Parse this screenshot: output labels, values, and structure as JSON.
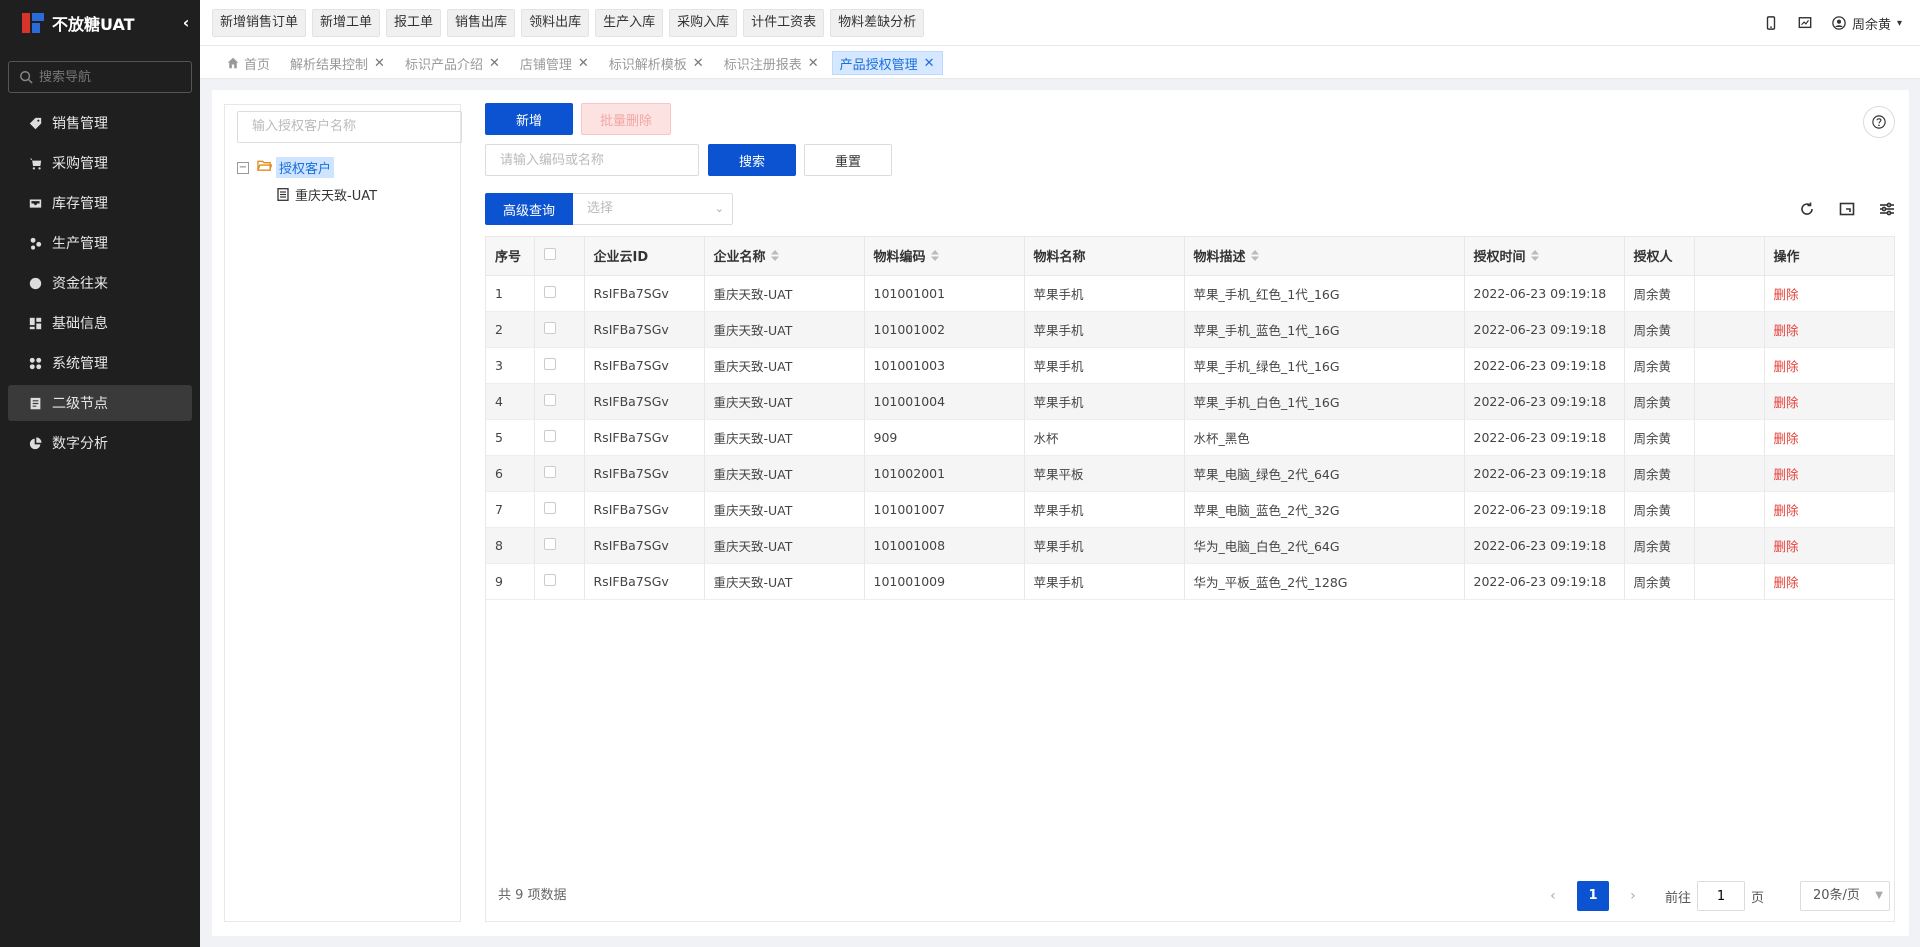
{
  "app": {
    "title": "不放糖UAT"
  },
  "sidebar": {
    "search_placeholder": "搜索导航",
    "items": [
      {
        "label": "销售管理",
        "icon": "tag-icon"
      },
      {
        "label": "采购管理",
        "icon": "cart-icon"
      },
      {
        "label": "库存管理",
        "icon": "inbox-icon"
      },
      {
        "label": "生产管理",
        "icon": "cluster-icon"
      },
      {
        "label": "资金往来",
        "icon": "money-icon"
      },
      {
        "label": "基础信息",
        "icon": "grid-icon"
      },
      {
        "label": "系统管理",
        "icon": "apps-icon"
      },
      {
        "label": "二级节点",
        "icon": "doc-icon",
        "active": true
      },
      {
        "label": "数字分析",
        "icon": "pie-icon"
      }
    ]
  },
  "topbar": {
    "quick_buttons": [
      "新增销售订单",
      "新增工单",
      "报工单",
      "销售出库",
      "领料出库",
      "生产入库",
      "采购入库",
      "计件工资表",
      "物料差缺分析"
    ],
    "user_name": "周余黄"
  },
  "tabs": [
    {
      "label": "首页",
      "closable": false,
      "active": false
    },
    {
      "label": "解析结果控制",
      "closable": true,
      "active": false
    },
    {
      "label": "标识产品介绍",
      "closable": true,
      "active": false
    },
    {
      "label": "店铺管理",
      "closable": true,
      "active": false
    },
    {
      "label": "标识解析模板",
      "closable": true,
      "active": false
    },
    {
      "label": "标识注册报表",
      "closable": true,
      "active": false
    },
    {
      "label": "产品授权管理",
      "closable": true,
      "active": true
    }
  ],
  "tree": {
    "search_placeholder": "输入授权客户名称",
    "root_label": "授权客户",
    "children": [
      "重庆天致-UAT"
    ]
  },
  "toolbar": {
    "add_label": "新增",
    "batch_delete_label": "批量删除",
    "search_placeholder": "请输入编码或名称",
    "search_label": "搜索",
    "reset_label": "重置",
    "advanced_label": "高级查询",
    "select_placeholder": "选择"
  },
  "table": {
    "columns": [
      "序号",
      "",
      "企业云ID",
      "企业名称",
      "物料编码",
      "物料名称",
      "物料描述",
      "授权时间",
      "授权人",
      "",
      "操作"
    ],
    "rows": [
      [
        "1",
        "RsIFBa7SGv",
        "重庆天致-UAT",
        "101001001",
        "苹果手机",
        "苹果_手机_红色_1代_16G",
        "2022-06-23 09:19:18",
        "周余黄",
        "删除"
      ],
      [
        "2",
        "RsIFBa7SGv",
        "重庆天致-UAT",
        "101001002",
        "苹果手机",
        "苹果_手机_蓝色_1代_16G",
        "2022-06-23 09:19:18",
        "周余黄",
        "删除"
      ],
      [
        "3",
        "RsIFBa7SGv",
        "重庆天致-UAT",
        "101001003",
        "苹果手机",
        "苹果_手机_绿色_1代_16G",
        "2022-06-23 09:19:18",
        "周余黄",
        "删除"
      ],
      [
        "4",
        "RsIFBa7SGv",
        "重庆天致-UAT",
        "101001004",
        "苹果手机",
        "苹果_手机_白色_1代_16G",
        "2022-06-23 09:19:18",
        "周余黄",
        "删除"
      ],
      [
        "5",
        "RsIFBa7SGv",
        "重庆天致-UAT",
        "909",
        "水杯",
        "水杯_黑色",
        "2022-06-23 09:19:18",
        "周余黄",
        "删除"
      ],
      [
        "6",
        "RsIFBa7SGv",
        "重庆天致-UAT",
        "101002001",
        "苹果平板",
        "苹果_电脑_绿色_2代_64G",
        "2022-06-23 09:19:18",
        "周余黄",
        "删除"
      ],
      [
        "7",
        "RsIFBa7SGv",
        "重庆天致-UAT",
        "101001007",
        "苹果手机",
        "苹果_电脑_蓝色_2代_32G",
        "2022-06-23 09:19:18",
        "周余黄",
        "删除"
      ],
      [
        "8",
        "RsIFBa7SGv",
        "重庆天致-UAT",
        "101001008",
        "苹果手机",
        "华为_电脑_白色_2代_64G",
        "2022-06-23 09:19:18",
        "周余黄",
        "删除"
      ],
      [
        "9",
        "RsIFBa7SGv",
        "重庆天致-UAT",
        "101001009",
        "苹果手机",
        "华为_平板_蓝色_2代_128G",
        "2022-06-23 09:19:18",
        "周余黄",
        "删除"
      ]
    ]
  },
  "pagination": {
    "total_text": "共 9 项数据",
    "current_page": "1",
    "goto_prefix": "前往",
    "goto_value": "1",
    "goto_suffix": "页",
    "page_size": "20条/页"
  },
  "colors": {
    "primary": "#0b53d1",
    "danger": "#e8403a",
    "sidebar_bg": "#1f1f1f"
  }
}
